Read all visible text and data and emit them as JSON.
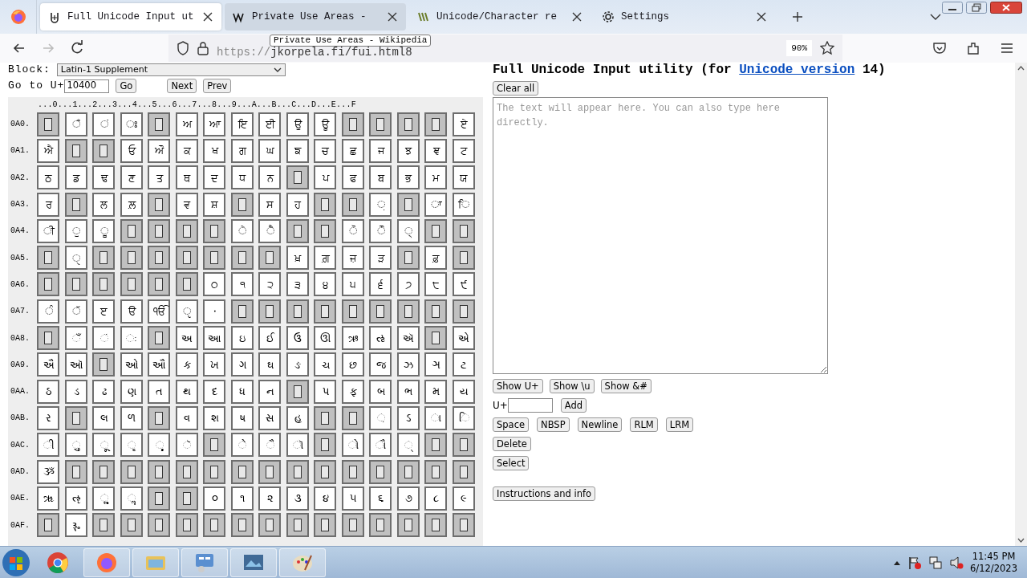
{
  "browser": {
    "tabs": [
      {
        "title": "Full Unicode Input ut",
        "selected": true
      },
      {
        "title": "Private Use Areas -",
        "selected": false
      },
      {
        "title": "Unicode/Character re",
        "selected": false
      },
      {
        "title": "Settings",
        "selected": false
      }
    ],
    "tooltip": "Private Use Areas - Wikipedia",
    "url_scheme": "https://",
    "url_rest": "jkorpela.fi/fui.html8",
    "zoom": "90%"
  },
  "page": {
    "block_label": "Block:",
    "block_value": "Latin-1 Supplement",
    "goto_label": "Go to U+",
    "goto_value": "10400",
    "goto_buttons": [
      "Go",
      "Next",
      "Prev"
    ],
    "column_header": "...0...1...2...3...4...5...6...7...8...9...A...B...C...D...E...F",
    "rows": [
      {
        "label": "0A0.",
        "cells": [
          {
            "kind": "unassigned"
          },
          {
            "kind": "char",
            "text": "◌ਁ"
          },
          {
            "kind": "char",
            "text": "◌ਂ"
          },
          {
            "kind": "char",
            "text": "◌ਃ"
          },
          {
            "kind": "unassigned"
          },
          {
            "kind": "char",
            "text": "ਅ"
          },
          {
            "kind": "char",
            "text": "ਆ"
          },
          {
            "kind": "char",
            "text": "ਇ"
          },
          {
            "kind": "char",
            "text": "ਈ"
          },
          {
            "kind": "char",
            "text": "ਉ"
          },
          {
            "kind": "char",
            "text": "ਊ"
          },
          {
            "kind": "unassigned"
          },
          {
            "kind": "unassigned"
          },
          {
            "kind": "unassigned"
          },
          {
            "kind": "unassigned"
          },
          {
            "kind": "char",
            "text": "ਏ"
          }
        ]
      },
      {
        "label": "0A1.",
        "cells": [
          {
            "kind": "char",
            "text": "ਐ"
          },
          {
            "kind": "unassigned"
          },
          {
            "kind": "unassigned"
          },
          {
            "kind": "char",
            "text": "ਓ"
          },
          {
            "kind": "char",
            "text": "ਔ"
          },
          {
            "kind": "char",
            "text": "ਕ"
          },
          {
            "kind": "char",
            "text": "ਖ"
          },
          {
            "kind": "char",
            "text": "ਗ"
          },
          {
            "kind": "char",
            "text": "ਘ"
          },
          {
            "kind": "char",
            "text": "ਙ"
          },
          {
            "kind": "char",
            "text": "ਚ"
          },
          {
            "kind": "char",
            "text": "ਛ"
          },
          {
            "kind": "char",
            "text": "ਜ"
          },
          {
            "kind": "char",
            "text": "ਝ"
          },
          {
            "kind": "char",
            "text": "ਞ"
          },
          {
            "kind": "char",
            "text": "ਟ"
          }
        ]
      },
      {
        "label": "0A2.",
        "cells": [
          {
            "kind": "char",
            "text": "ਠ"
          },
          {
            "kind": "char",
            "text": "ਡ"
          },
          {
            "kind": "char",
            "text": "ਢ"
          },
          {
            "kind": "char",
            "text": "ਣ"
          },
          {
            "kind": "char",
            "text": "ਤ"
          },
          {
            "kind": "char",
            "text": "ਥ"
          },
          {
            "kind": "char",
            "text": "ਦ"
          },
          {
            "kind": "char",
            "text": "ਧ"
          },
          {
            "kind": "char",
            "text": "ਨ"
          },
          {
            "kind": "unassigned"
          },
          {
            "kind": "char",
            "text": "ਪ"
          },
          {
            "kind": "char",
            "text": "ਫ"
          },
          {
            "kind": "char",
            "text": "ਬ"
          },
          {
            "kind": "char",
            "text": "ਭ"
          },
          {
            "kind": "char",
            "text": "ਮ"
          },
          {
            "kind": "char",
            "text": "ਯ"
          }
        ]
      },
      {
        "label": "0A3.",
        "cells": [
          {
            "kind": "char",
            "text": "ਰ"
          },
          {
            "kind": "unassigned"
          },
          {
            "kind": "char",
            "text": "ਲ"
          },
          {
            "kind": "char",
            "text": "ਲ਼"
          },
          {
            "kind": "unassigned"
          },
          {
            "kind": "char",
            "text": "ਵ"
          },
          {
            "kind": "char",
            "text": "ਸ਼"
          },
          {
            "kind": "unassigned"
          },
          {
            "kind": "char",
            "text": "ਸ"
          },
          {
            "kind": "char",
            "text": "ਹ"
          },
          {
            "kind": "unassigned"
          },
          {
            "kind": "unassigned"
          },
          {
            "kind": "char",
            "text": "◌਼"
          },
          {
            "kind": "unassigned"
          },
          {
            "kind": "char",
            "text": "◌ਾ"
          },
          {
            "kind": "char",
            "text": "◌ਿ"
          }
        ]
      },
      {
        "label": "0A4.",
        "cells": [
          {
            "kind": "char",
            "text": "◌ੀ"
          },
          {
            "kind": "char",
            "text": "◌ੁ"
          },
          {
            "kind": "char",
            "text": "◌ੂ"
          },
          {
            "kind": "unassigned"
          },
          {
            "kind": "unassigned"
          },
          {
            "kind": "unassigned"
          },
          {
            "kind": "unassigned"
          },
          {
            "kind": "char",
            "text": "◌ੇ"
          },
          {
            "kind": "char",
            "text": "◌ੈ"
          },
          {
            "kind": "unassigned"
          },
          {
            "kind": "unassigned"
          },
          {
            "kind": "char",
            "text": "◌ੋ"
          },
          {
            "kind": "char",
            "text": "◌ੌ"
          },
          {
            "kind": "char",
            "text": "◌੍"
          },
          {
            "kind": "unassigned"
          },
          {
            "kind": "unassigned"
          }
        ]
      },
      {
        "label": "0A5.",
        "cells": [
          {
            "kind": "unassigned"
          },
          {
            "kind": "char",
            "text": "◌ੑ"
          },
          {
            "kind": "unassigned"
          },
          {
            "kind": "unassigned"
          },
          {
            "kind": "unassigned"
          },
          {
            "kind": "unassigned"
          },
          {
            "kind": "unassigned"
          },
          {
            "kind": "unassigned"
          },
          {
            "kind": "unassigned"
          },
          {
            "kind": "char",
            "text": "ਖ਼"
          },
          {
            "kind": "char",
            "text": "ਗ਼"
          },
          {
            "kind": "char",
            "text": "ਜ਼"
          },
          {
            "kind": "char",
            "text": "ੜ"
          },
          {
            "kind": "unassigned"
          },
          {
            "kind": "char",
            "text": "ਫ਼"
          },
          {
            "kind": "unassigned"
          }
        ]
      },
      {
        "label": "0A6.",
        "cells": [
          {
            "kind": "unassigned"
          },
          {
            "kind": "unassigned"
          },
          {
            "kind": "unassigned"
          },
          {
            "kind": "unassigned"
          },
          {
            "kind": "unassigned"
          },
          {
            "kind": "unassigned"
          },
          {
            "kind": "char",
            "text": "੦"
          },
          {
            "kind": "char",
            "text": "੧"
          },
          {
            "kind": "char",
            "text": "੨"
          },
          {
            "kind": "char",
            "text": "੩"
          },
          {
            "kind": "char",
            "text": "੪"
          },
          {
            "kind": "char",
            "text": "੫"
          },
          {
            "kind": "char",
            "text": "੬"
          },
          {
            "kind": "char",
            "text": "੭"
          },
          {
            "kind": "char",
            "text": "੮"
          },
          {
            "kind": "char",
            "text": "੯"
          }
        ]
      },
      {
        "label": "0A7.",
        "cells": [
          {
            "kind": "char",
            "text": "◌ੰ"
          },
          {
            "kind": "char",
            "text": "◌ੱ"
          },
          {
            "kind": "char",
            "text": "ੲ"
          },
          {
            "kind": "char",
            "text": "ੳ"
          },
          {
            "kind": "char",
            "text": "ੴ"
          },
          {
            "kind": "char",
            "text": "◌ੵ"
          },
          {
            "kind": "char",
            "text": "੶"
          },
          {
            "kind": "unassigned"
          },
          {
            "kind": "unassigned"
          },
          {
            "kind": "unassigned"
          },
          {
            "kind": "unassigned"
          },
          {
            "kind": "unassigned"
          },
          {
            "kind": "unassigned"
          },
          {
            "kind": "unassigned"
          },
          {
            "kind": "unassigned"
          },
          {
            "kind": "unassigned"
          }
        ]
      },
      {
        "label": "0A8.",
        "cells": [
          {
            "kind": "unassigned"
          },
          {
            "kind": "char",
            "text": "◌ઁ"
          },
          {
            "kind": "char",
            "text": "◌ં"
          },
          {
            "kind": "char",
            "text": "◌ઃ"
          },
          {
            "kind": "unassigned"
          },
          {
            "kind": "char",
            "text": "અ"
          },
          {
            "kind": "char",
            "text": "આ"
          },
          {
            "kind": "char",
            "text": "ઇ"
          },
          {
            "kind": "char",
            "text": "ઈ"
          },
          {
            "kind": "char",
            "text": "ઉ"
          },
          {
            "kind": "char",
            "text": "ઊ"
          },
          {
            "kind": "char",
            "text": "ઋ"
          },
          {
            "kind": "char",
            "text": "ઌ"
          },
          {
            "kind": "char",
            "text": "ઍ"
          },
          {
            "kind": "unassigned"
          },
          {
            "kind": "char",
            "text": "એ"
          }
        ]
      },
      {
        "label": "0A9.",
        "cells": [
          {
            "kind": "char",
            "text": "ઐ"
          },
          {
            "kind": "char",
            "text": "ઑ"
          },
          {
            "kind": "unassigned"
          },
          {
            "kind": "char",
            "text": "ઓ"
          },
          {
            "kind": "char",
            "text": "ઔ"
          },
          {
            "kind": "char",
            "text": "ક"
          },
          {
            "kind": "char",
            "text": "ખ"
          },
          {
            "kind": "char",
            "text": "ગ"
          },
          {
            "kind": "char",
            "text": "ઘ"
          },
          {
            "kind": "char",
            "text": "ઙ"
          },
          {
            "kind": "char",
            "text": "ચ"
          },
          {
            "kind": "char",
            "text": "છ"
          },
          {
            "kind": "char",
            "text": "જ"
          },
          {
            "kind": "char",
            "text": "ઝ"
          },
          {
            "kind": "char",
            "text": "ઞ"
          },
          {
            "kind": "char",
            "text": "ટ"
          }
        ]
      },
      {
        "label": "0AA.",
        "cells": [
          {
            "kind": "char",
            "text": "ઠ"
          },
          {
            "kind": "char",
            "text": "ડ"
          },
          {
            "kind": "char",
            "text": "ઢ"
          },
          {
            "kind": "char",
            "text": "ણ"
          },
          {
            "kind": "char",
            "text": "ત"
          },
          {
            "kind": "char",
            "text": "થ"
          },
          {
            "kind": "char",
            "text": "દ"
          },
          {
            "kind": "char",
            "text": "ધ"
          },
          {
            "kind": "char",
            "text": "ન"
          },
          {
            "kind": "unassigned"
          },
          {
            "kind": "char",
            "text": "પ"
          },
          {
            "kind": "char",
            "text": "ફ"
          },
          {
            "kind": "char",
            "text": "બ"
          },
          {
            "kind": "char",
            "text": "ભ"
          },
          {
            "kind": "char",
            "text": "મ"
          },
          {
            "kind": "char",
            "text": "ય"
          }
        ]
      },
      {
        "label": "0AB.",
        "cells": [
          {
            "kind": "char",
            "text": "ર"
          },
          {
            "kind": "unassigned"
          },
          {
            "kind": "char",
            "text": "લ"
          },
          {
            "kind": "char",
            "text": "ળ"
          },
          {
            "kind": "unassigned"
          },
          {
            "kind": "char",
            "text": "વ"
          },
          {
            "kind": "char",
            "text": "શ"
          },
          {
            "kind": "char",
            "text": "ષ"
          },
          {
            "kind": "char",
            "text": "સ"
          },
          {
            "kind": "char",
            "text": "હ"
          },
          {
            "kind": "unassigned"
          },
          {
            "kind": "unassigned"
          },
          {
            "kind": "char",
            "text": "◌઼"
          },
          {
            "kind": "char",
            "text": "ઽ"
          },
          {
            "kind": "char",
            "text": "◌ા"
          },
          {
            "kind": "char",
            "text": "◌િ"
          }
        ]
      },
      {
        "label": "0AC.",
        "cells": [
          {
            "kind": "char",
            "text": "◌ી"
          },
          {
            "kind": "char",
            "text": "◌ુ"
          },
          {
            "kind": "char",
            "text": "◌ૂ"
          },
          {
            "kind": "char",
            "text": "◌ૃ"
          },
          {
            "kind": "char",
            "text": "◌ૄ"
          },
          {
            "kind": "char",
            "text": "◌ૅ"
          },
          {
            "kind": "unassigned"
          },
          {
            "kind": "char",
            "text": "◌ે"
          },
          {
            "kind": "char",
            "text": "◌ૈ"
          },
          {
            "kind": "char",
            "text": "◌ૉ"
          },
          {
            "kind": "unassigned"
          },
          {
            "kind": "char",
            "text": "◌ો"
          },
          {
            "kind": "char",
            "text": "◌ૌ"
          },
          {
            "kind": "char",
            "text": "◌્"
          },
          {
            "kind": "unassigned"
          },
          {
            "kind": "unassigned"
          }
        ]
      },
      {
        "label": "0AD.",
        "cells": [
          {
            "kind": "char",
            "text": "ૐ"
          },
          {
            "kind": "unassigned"
          },
          {
            "kind": "unassigned"
          },
          {
            "kind": "unassigned"
          },
          {
            "kind": "unassigned"
          },
          {
            "kind": "unassigned"
          },
          {
            "kind": "unassigned"
          },
          {
            "kind": "unassigned"
          },
          {
            "kind": "unassigned"
          },
          {
            "kind": "unassigned"
          },
          {
            "kind": "unassigned"
          },
          {
            "kind": "unassigned"
          },
          {
            "kind": "unassigned"
          },
          {
            "kind": "unassigned"
          },
          {
            "kind": "unassigned"
          },
          {
            "kind": "unassigned"
          }
        ]
      },
      {
        "label": "0AE.",
        "cells": [
          {
            "kind": "char",
            "text": "ૠ"
          },
          {
            "kind": "char",
            "text": "ૡ"
          },
          {
            "kind": "char",
            "text": "◌ૢ"
          },
          {
            "kind": "char",
            "text": "◌ૣ"
          },
          {
            "kind": "unassigned"
          },
          {
            "kind": "unassigned"
          },
          {
            "kind": "char",
            "text": "૦"
          },
          {
            "kind": "char",
            "text": "૧"
          },
          {
            "kind": "char",
            "text": "૨"
          },
          {
            "kind": "char",
            "text": "૩"
          },
          {
            "kind": "char",
            "text": "૪"
          },
          {
            "kind": "char",
            "text": "૫"
          },
          {
            "kind": "char",
            "text": "૬"
          },
          {
            "kind": "char",
            "text": "૭"
          },
          {
            "kind": "char",
            "text": "૮"
          },
          {
            "kind": "char",
            "text": "૯"
          }
        ]
      },
      {
        "label": "0AF.",
        "cells": [
          {
            "kind": "unassigned"
          },
          {
            "kind": "char",
            "text": "૱"
          },
          {
            "kind": "unassigned"
          },
          {
            "kind": "unassigned"
          },
          {
            "kind": "unassigned"
          },
          {
            "kind": "unassigned"
          },
          {
            "kind": "unassigned"
          },
          {
            "kind": "unassigned"
          },
          {
            "kind": "unassigned"
          },
          {
            "kind": "unassigned"
          },
          {
            "kind": "unassigned"
          },
          {
            "kind": "unassigned"
          },
          {
            "kind": "unassigned"
          },
          {
            "kind": "unassigned"
          },
          {
            "kind": "unassigned"
          },
          {
            "kind": "unassigned"
          }
        ]
      }
    ],
    "title_start": "Full Unicode Input utility (for ",
    "title_link": "Unicode version",
    "title_end": " 14)",
    "clear_button": "Clear all",
    "textarea_placeholder": "The text will appear here. You can also type here directly.",
    "show_buttons": [
      "Show U+",
      "Show \\u",
      "Show &#"
    ],
    "add_label": "U+",
    "add_button": "Add",
    "insert_buttons": [
      "Space",
      "NBSP",
      "Newline",
      "RLM",
      "LRM"
    ],
    "delete_button": "Delete",
    "select_button": "Select",
    "info_button": "Instructions and info"
  },
  "taskbar": {
    "time": "11:45 PM",
    "date": "6/12/2023"
  }
}
